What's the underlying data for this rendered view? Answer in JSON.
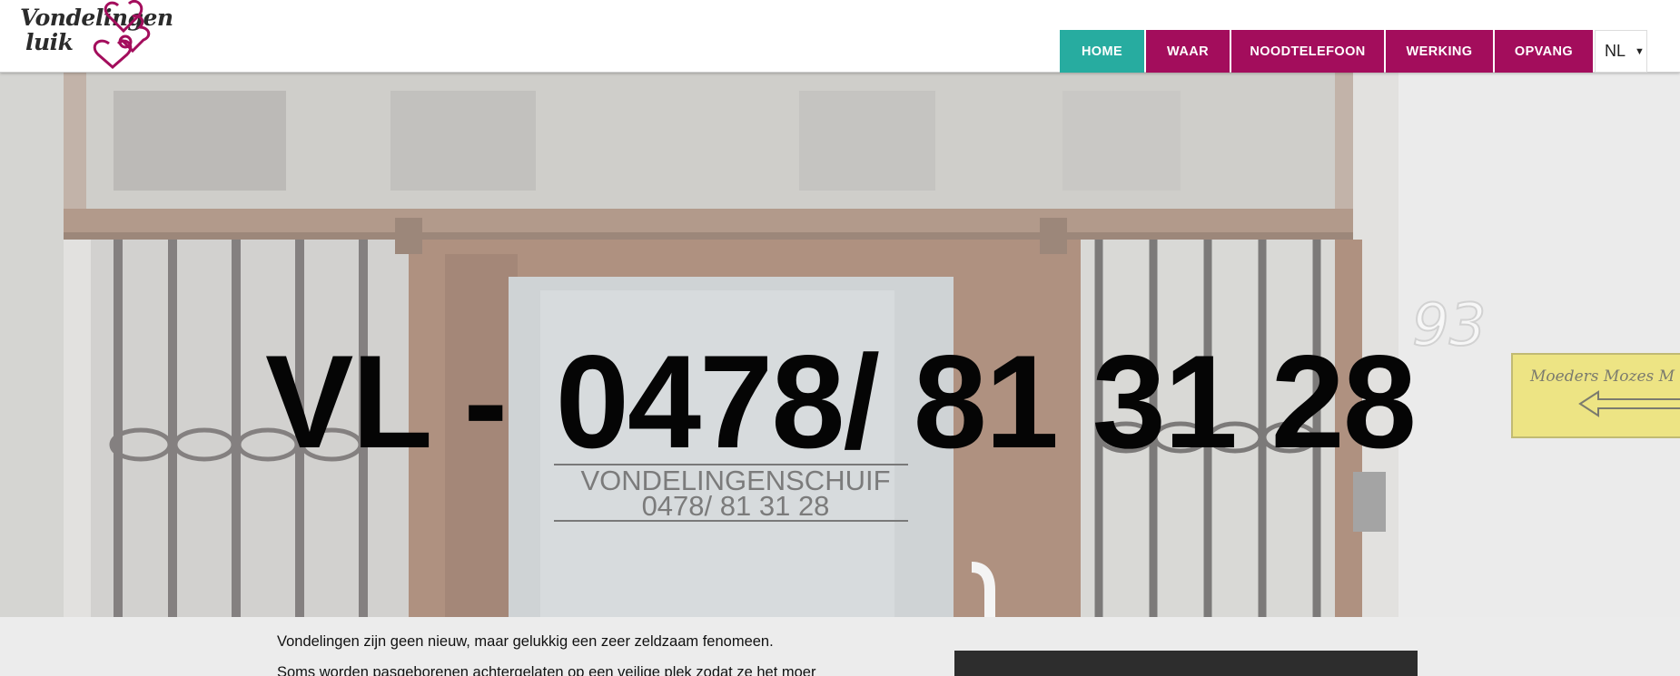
{
  "header": {
    "logo": {
      "line1": "Vondelingen",
      "line2": "luik",
      "accent_color": "#a30d5c"
    },
    "nav": [
      {
        "label": "HOME",
        "active": true
      },
      {
        "label": "WAAR",
        "active": false
      },
      {
        "label": "NOODTELEFOON",
        "active": false
      },
      {
        "label": "WERKING",
        "active": false
      },
      {
        "label": "OPVANG",
        "active": false
      }
    ],
    "language": {
      "selected": "NL",
      "icon": "chevron-down-icon"
    },
    "colors": {
      "active": "#27aca0",
      "nav": "#a30d5c"
    }
  },
  "hero": {
    "phone_prefix": "VL -",
    "phone_number": "0478/ 81 31 28",
    "door_sign": {
      "line1": "VONDELINGENSCHUIF",
      "line2": "0478/ 81 31 28"
    },
    "house_number": "93",
    "plaque_text": "Moeders Mozes M"
  },
  "content": {
    "paragraph1": "Vondelingen zijn geen nieuw, maar gelukkig een zeer zeldzaam fenomeen.",
    "paragraph2": "Soms worden pasgeborenen achtergelaten op een veilige plek zodat ze het moer"
  }
}
